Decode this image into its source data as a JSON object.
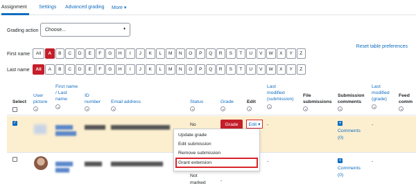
{
  "nav": {
    "tabs": [
      "Assignment",
      "Settings",
      "Advanced grading",
      "More ▾"
    ]
  },
  "grading_action": {
    "label": "Grading action",
    "value": "Choose...",
    "caret": "♦"
  },
  "reset_link": "Reset table preferences",
  "initials": {
    "first_label": "First name",
    "last_label": "Last name",
    "all": "All",
    "letters": [
      "A",
      "B",
      "C",
      "D",
      "E",
      "F",
      "G",
      "H",
      "I",
      "J",
      "K",
      "L",
      "M",
      "N",
      "O",
      "P",
      "Q",
      "R",
      "S",
      "T",
      "U",
      "V",
      "W",
      "X",
      "Y",
      "Z"
    ],
    "first_active": "A",
    "last_active": "All"
  },
  "table": {
    "headers": {
      "select": "Select",
      "user_picture": [
        "User",
        "picture"
      ],
      "name": [
        "First name",
        "/ Last",
        "name"
      ],
      "id_number": [
        "ID",
        "number"
      ],
      "email": "Email address",
      "status": "Status",
      "grade": "Grade",
      "edit": "Edit",
      "last_modified_submission": [
        "Last",
        "modified",
        "(submission)"
      ],
      "file_submissions": [
        "File",
        "submissions"
      ],
      "submission_comments": [
        "Submission",
        "comments"
      ],
      "last_modified_grade": [
        "Last",
        "modified",
        "(grade)"
      ],
      "feedback": [
        "Feed",
        "comm"
      ]
    },
    "rows": [
      {
        "status": "No",
        "grade_button": "Grade",
        "edit_button": "Edit ▾",
        "last_modified": "-",
        "comments_label": "Comments",
        "comments_count": "(0)",
        "last_modified_grade": "-"
      },
      {
        "status_lines": [
          "Not",
          "marked"
        ],
        "grade_value": "-",
        "last_modified": "-",
        "comments_label": "Comments",
        "comments_count": "(0)",
        "last_modified_grade": "-"
      }
    ]
  },
  "edit_menu": {
    "items": [
      "Update grade",
      "Edit submission",
      "Remove submission",
      "Grant extension"
    ],
    "highlighted": "Grant extension"
  },
  "colors": {
    "accent": "#0f6cbf",
    "active_red": "#c41e2b",
    "row_highlight": "#fcefd0"
  }
}
